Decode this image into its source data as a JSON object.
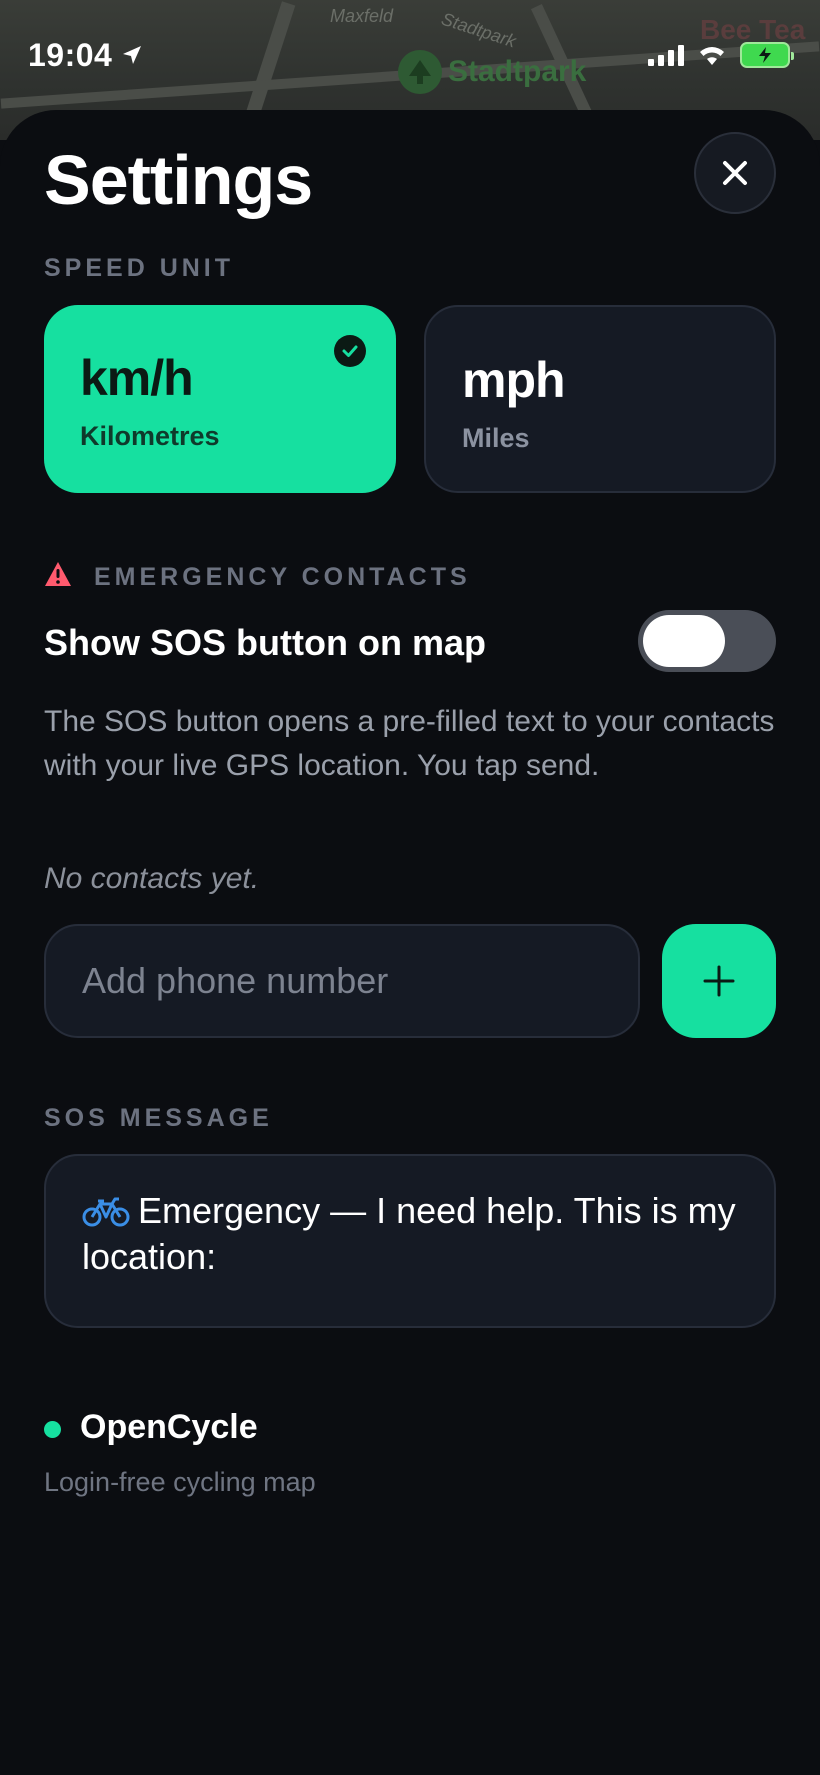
{
  "status_bar": {
    "time": "19:04"
  },
  "map": {
    "labels": [
      "Maxfeld",
      "Stadtpark"
    ],
    "park_label": "Stadtpark",
    "poi_label": "Bee Tea"
  },
  "header": {
    "title": "Settings"
  },
  "speed_unit": {
    "section_label": "SPEED UNIT",
    "options": [
      {
        "main": "km/h",
        "sub": "Kilometres",
        "selected": true
      },
      {
        "main": "mph",
        "sub": "Miles",
        "selected": false
      }
    ]
  },
  "emergency": {
    "section_label": "EMERGENCY CONTACTS",
    "toggle_label": "Show SOS button on map",
    "toggle_on": false,
    "description": "The SOS button opens a pre-filled text to your contacts with your live GPS location. You tap send.",
    "empty_text": "No contacts yet.",
    "phone_placeholder": "Add phone number"
  },
  "sos_message": {
    "section_label": "SOS MESSAGE",
    "text": "Emergency — I need help. This is my location:"
  },
  "footer": {
    "app_name": "OpenCycle",
    "tagline": "Login-free cycling map"
  },
  "colors": {
    "accent": "#16e0a0",
    "background": "#0b0d11",
    "card": "#151a24",
    "warning": "#ff5a6e"
  }
}
